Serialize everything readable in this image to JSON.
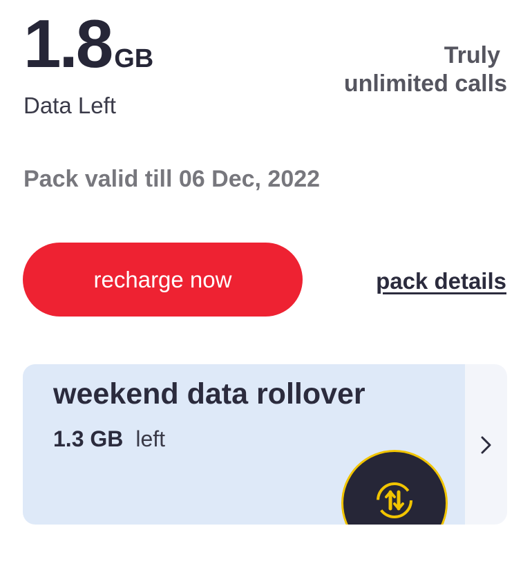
{
  "data_balance": {
    "value": "1.8",
    "unit": "GB",
    "label": "Data Left"
  },
  "calls": {
    "line1": "Truly",
    "line2": "unlimited calls"
  },
  "validity_text": "Pack valid till 06 Dec, 2022",
  "actions": {
    "recharge_label": "recharge now",
    "pack_details_label": "pack details"
  },
  "rollover": {
    "title": "weekend data rollover",
    "value": "1.3 GB",
    "suffix": "left",
    "icon": "data-rollover-icon"
  },
  "colors": {
    "accent": "#ee2232",
    "card_bg": "#dee9f8",
    "badge_ring": "#f1c400"
  }
}
